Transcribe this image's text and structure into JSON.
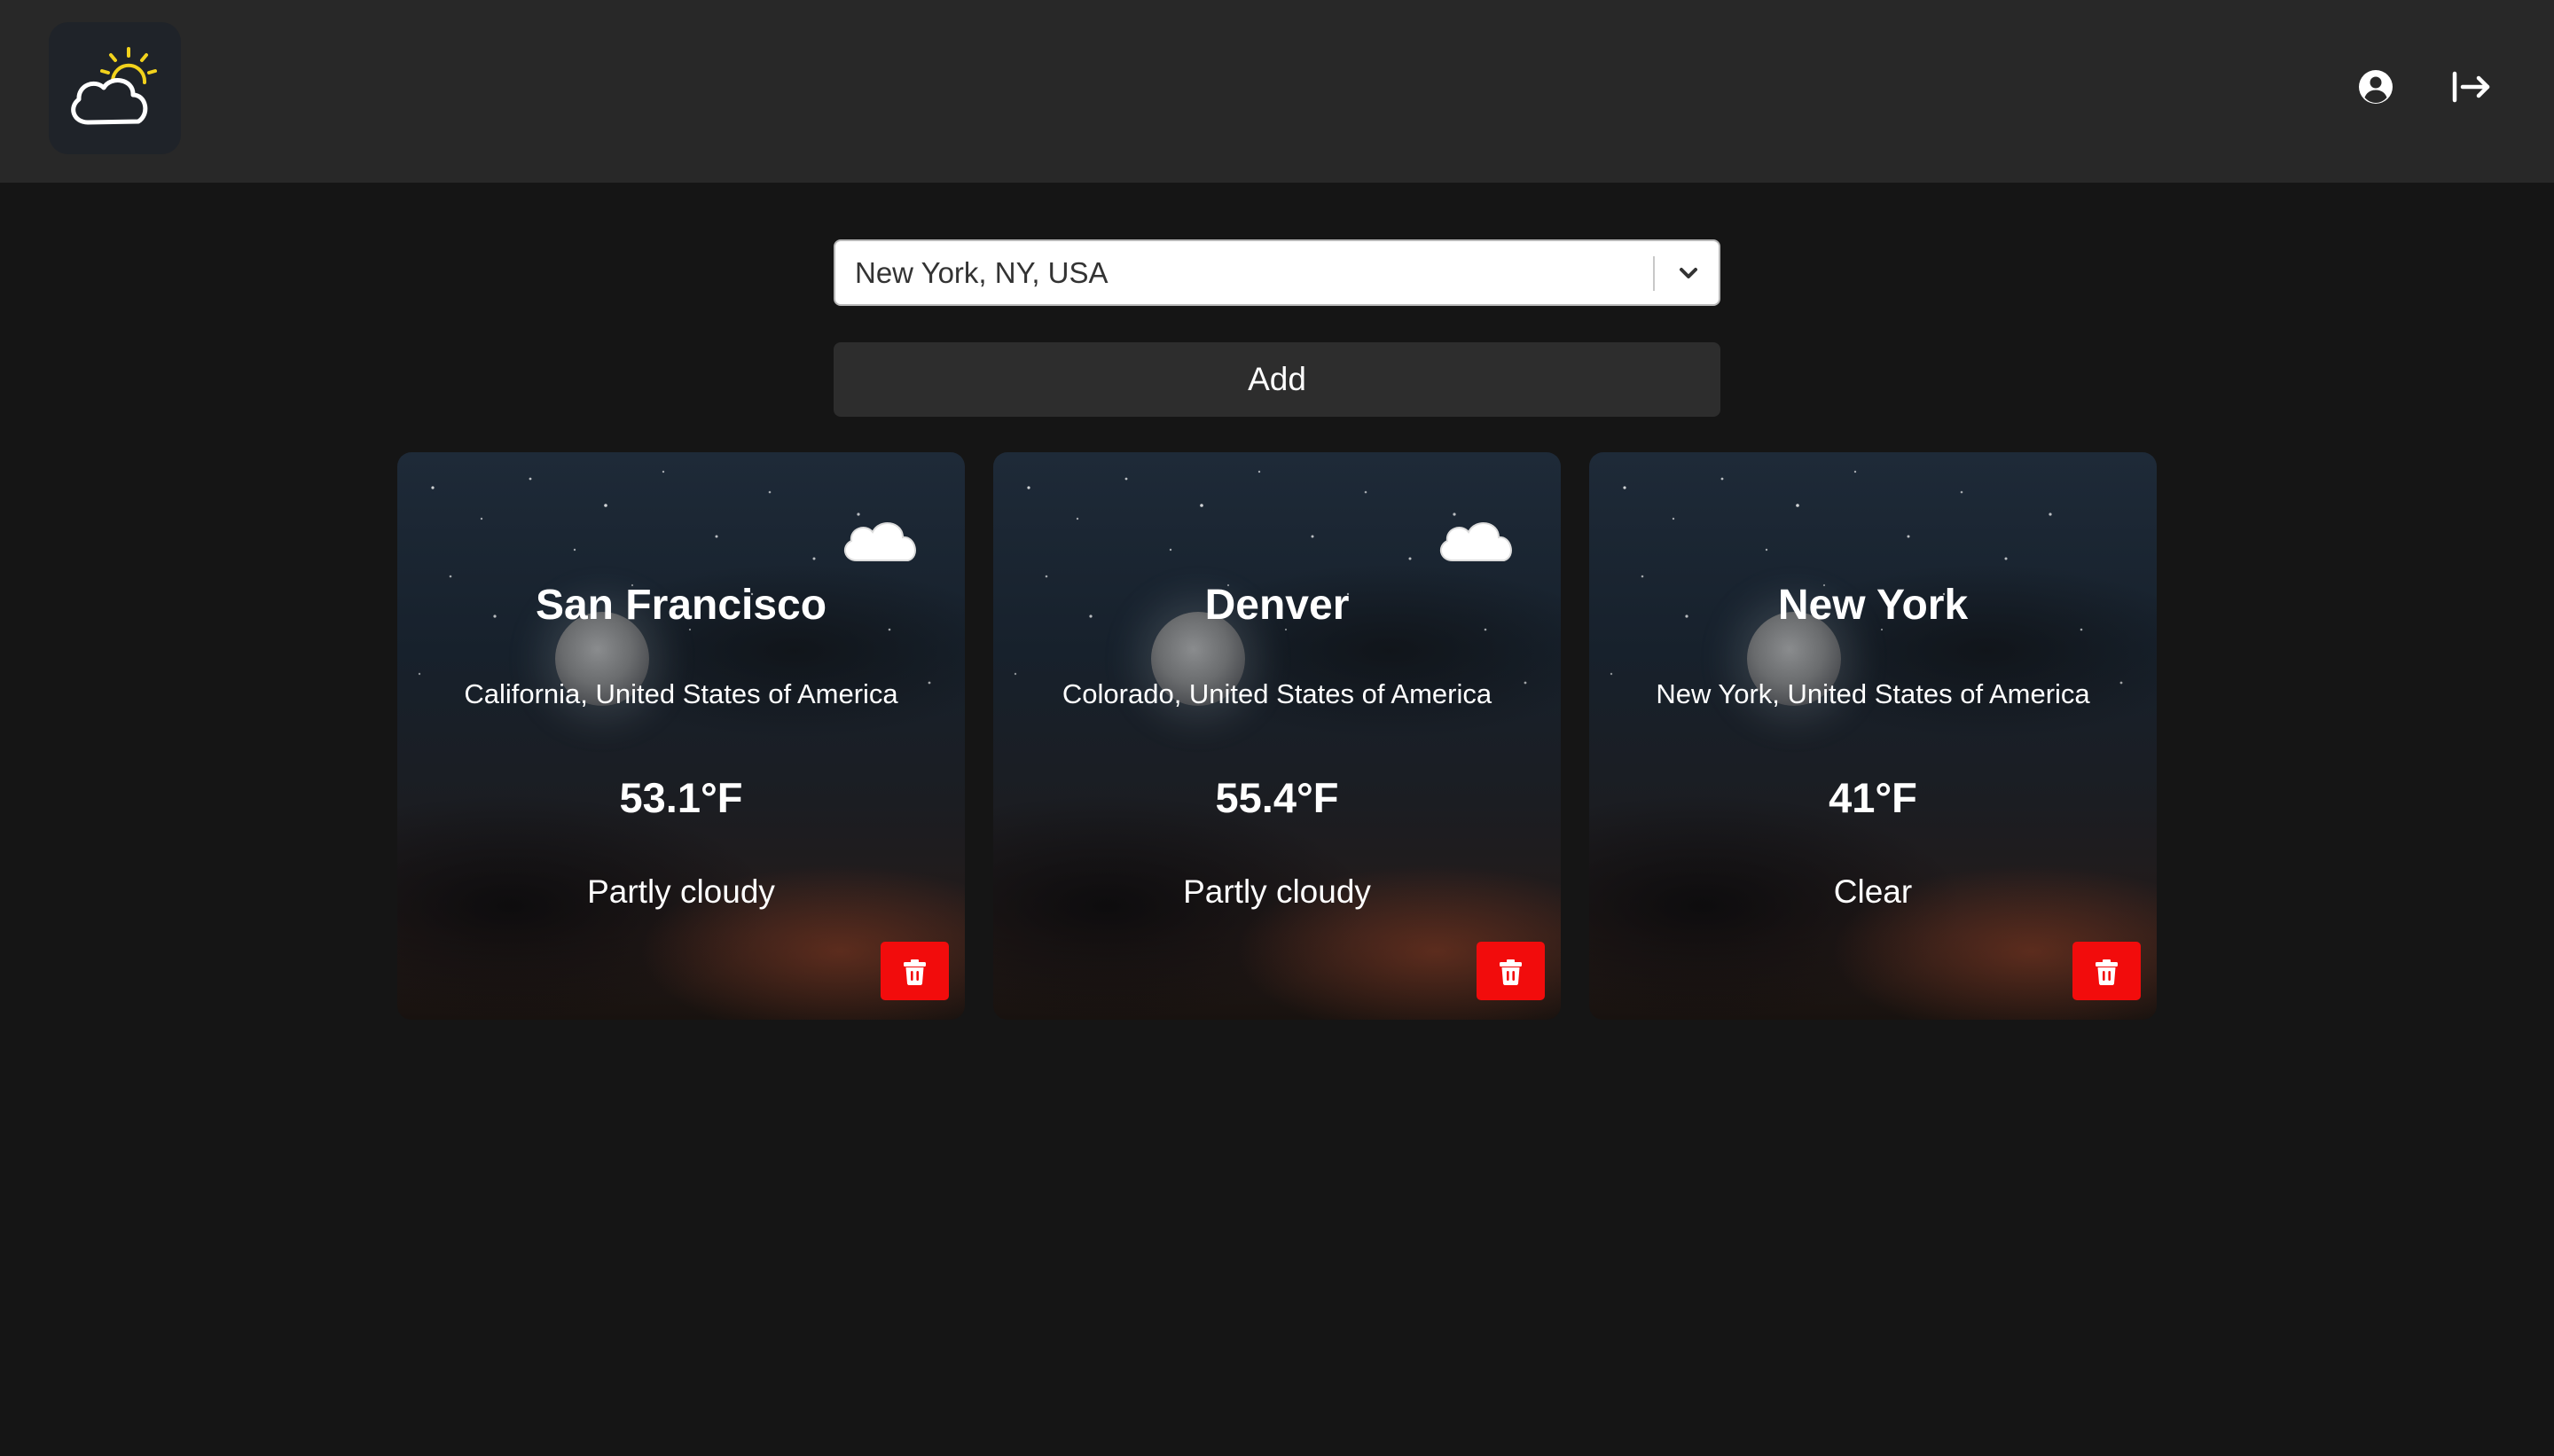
{
  "header": {
    "logo_icon": "partly-sunny-cloud-icon",
    "account_icon": "user-circle-icon",
    "logout_icon": "logout-arrow-icon"
  },
  "location_select": {
    "value": "New York, NY, USA",
    "indicator_icon": "chevron-down-icon"
  },
  "add_button": {
    "label": "Add"
  },
  "cards": [
    {
      "city": "San Francisco",
      "region": "California, United States of America",
      "temperature": "53.1°F",
      "condition": "Partly cloudy",
      "icon": "night-partly-cloudy-icon",
      "delete_icon": "trash-icon"
    },
    {
      "city": "Denver",
      "region": "Colorado, United States of America",
      "temperature": "55.4°F",
      "condition": "Partly cloudy",
      "icon": "night-partly-cloudy-icon",
      "delete_icon": "trash-icon"
    },
    {
      "city": "New York",
      "region": "New York, United States of America",
      "temperature": "41°F",
      "condition": "Clear",
      "icon": "night-clear-moon-icon",
      "delete_icon": "trash-icon"
    }
  ],
  "colors": {
    "header_bg": "#282828",
    "page_bg": "#151515",
    "delete_red": "#f20c0c",
    "moon_blue": "#1a6fd6",
    "sun_yellow": "#f2d21c"
  }
}
